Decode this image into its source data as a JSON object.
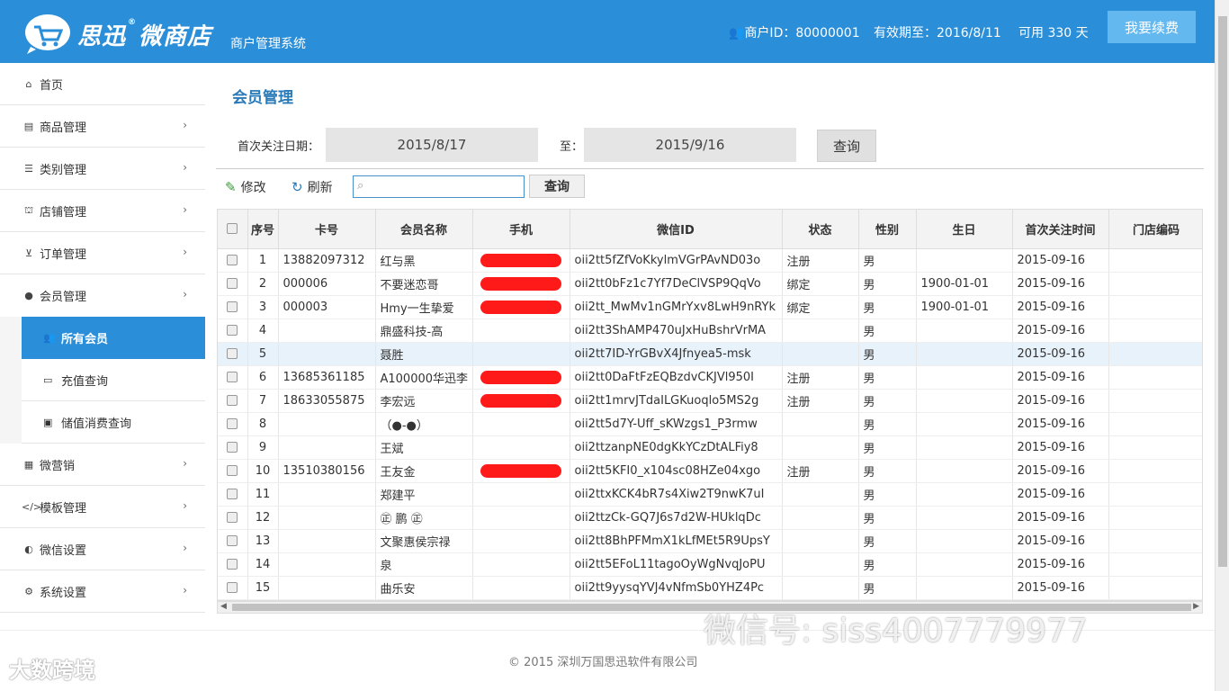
{
  "header": {
    "brand": "思迅",
    "brand_reg": "®",
    "brand2": "微商店",
    "subtitle": "商户管理系统",
    "merchant_id": "商户ID：80000001",
    "valid_until": "有效期至：2016/8/11",
    "available": "可用 330 天",
    "renew_label": "我要续费"
  },
  "sidebar": {
    "home": "首页",
    "items": [
      "商品管理",
      "类别管理",
      "店铺管理",
      "订单管理",
      "会员管理"
    ],
    "member_sub": [
      "所有会员",
      "充值查询",
      "储值消费查询"
    ],
    "items2": [
      "微营销",
      "模板管理",
      "微信设置",
      "系统设置"
    ]
  },
  "main": {
    "title": "会员管理",
    "date_from_label": "首次关注日期：",
    "date_from": "2015/8/17",
    "date_to_label": "至：",
    "date_to": "2015/9/16",
    "query_label": "查询",
    "edit_label": "修改",
    "refresh_label": "刷新",
    "search_query_label": "查询"
  },
  "table": {
    "columns": [
      "序号",
      "卡号",
      "会员名称",
      "手机",
      "微信ID",
      "状态",
      "性别",
      "生日",
      "首次关注时间",
      "门店编码"
    ],
    "rows": [
      {
        "no": "1",
        "card": "13882097312",
        "name": "红与黑",
        "phone": true,
        "wx": "oii2tt5fZfVoKkylmVGrPAvND03o",
        "status": "注册",
        "sex": "男",
        "bday": "",
        "first": "2015-09-16"
      },
      {
        "no": "2",
        "card": "000006",
        "name": "不要迷恋哥",
        "phone": true,
        "wx": "oii2tt0bFz1c7Yf7DeClVSP9QqVo",
        "status": "绑定",
        "sex": "男",
        "bday": "1900-01-01",
        "first": "2015-09-16"
      },
      {
        "no": "3",
        "card": "000003",
        "name": "Hmy一生挚爱",
        "phone": true,
        "wx": "oii2tt_MwMv1nGMrYxv8LwH9nRYk",
        "status": "绑定",
        "sex": "男",
        "bday": "1900-01-01",
        "first": "2015-09-16"
      },
      {
        "no": "4",
        "card": "",
        "name": "鼎盛科技-高",
        "phone": false,
        "wx": "oii2tt3ShAMP470uJxHuBshrVrMA",
        "status": "",
        "sex": "男",
        "bday": "",
        "first": "2015-09-16"
      },
      {
        "no": "5",
        "card": "",
        "name": "聂胜",
        "phone": false,
        "wx": "oii2tt7ID-YrGBvX4Jfnyea5-msk",
        "status": "",
        "sex": "男",
        "bday": "",
        "first": "2015-09-16"
      },
      {
        "no": "6",
        "card": "13685361185",
        "name": "A100000华迅李",
        "phone": true,
        "wx": "oii2tt0DaFtFzEQBzdvCKJVl950I",
        "status": "注册",
        "sex": "男",
        "bday": "",
        "first": "2015-09-16"
      },
      {
        "no": "7",
        "card": "18633055875",
        "name": "李宏远",
        "phone": true,
        "wx": "oii2tt1mrvJTdaILGKuoqlo5MS2g",
        "status": "注册",
        "sex": "男",
        "bday": "",
        "first": "2015-09-16"
      },
      {
        "no": "8",
        "card": "",
        "name": "（●-●）",
        "phone": false,
        "wx": "oii2tt5d7Y-Uff_sKWzgs1_P3rmw",
        "status": "",
        "sex": "男",
        "bday": "",
        "first": "2015-09-16"
      },
      {
        "no": "9",
        "card": "",
        "name": "王斌",
        "phone": false,
        "wx": "oii2ttzanpNE0dgKkYCzDtALFiy8",
        "status": "",
        "sex": "男",
        "bday": "",
        "first": "2015-09-16"
      },
      {
        "no": "10",
        "card": "13510380156",
        "name": "王友金",
        "phone": true,
        "wx": "oii2tt5KFI0_x104sc08HZe04xgo",
        "status": "注册",
        "sex": "男",
        "bday": "",
        "first": "2015-09-16"
      },
      {
        "no": "11",
        "card": "",
        "name": "郑建平",
        "phone": false,
        "wx": "oii2ttxKCK4bR7s4Xiw2T9nwK7uI",
        "status": "",
        "sex": "男",
        "bday": "",
        "first": "2015-09-16"
      },
      {
        "no": "12",
        "card": "",
        "name": "㊣ 鹏 ㊣",
        "phone": false,
        "wx": "oii2ttzCk-GQ7J6s7d2W-HUklqDc",
        "status": "",
        "sex": "男",
        "bday": "",
        "first": "2015-09-16"
      },
      {
        "no": "13",
        "card": "",
        "name": "文聚惠侯宗禄",
        "phone": false,
        "wx": "oii2tt8BhPFMmX1kLfMEt5R9UpsY",
        "status": "",
        "sex": "男",
        "bday": "",
        "first": "2015-09-16"
      },
      {
        "no": "14",
        "card": "",
        "name": "泉",
        "phone": false,
        "wx": "oii2tt5EFoL11tagoOyWgNvqJoPU",
        "status": "",
        "sex": "男",
        "bday": "",
        "first": "2015-09-16"
      },
      {
        "no": "15",
        "card": "",
        "name": "曲乐安",
        "phone": false,
        "wx": "oii2tt9yysqYVJ4vNfmSb0YHZ4Pc",
        "status": "",
        "sex": "男",
        "bday": "",
        "first": "2015-09-16"
      }
    ]
  },
  "footer": {
    "copyright": "© 2015 深圳万国思迅软件有限公司",
    "watermark_left": "大数跨境",
    "watermark_right": "微信号: siss4007779977"
  },
  "colors": {
    "brand_blue": "#2a8ed8",
    "renew_button": "#63b8f0",
    "title_blue": "#2a7ab8",
    "redaction_red": "#ff1a1a"
  }
}
